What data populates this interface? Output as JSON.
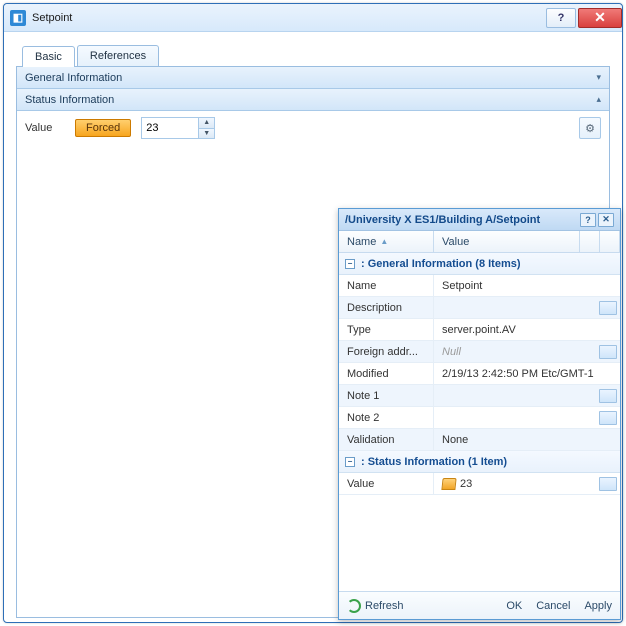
{
  "window": {
    "title": "Setpoint",
    "icon": "setpoint-icon"
  },
  "tabs": [
    {
      "label": "Basic",
      "active": true
    },
    {
      "label": "References",
      "active": false
    }
  ],
  "sections": {
    "general": {
      "title": "General Information",
      "expanded": false
    },
    "status": {
      "title": "Status Information",
      "expanded": true
    }
  },
  "value_row": {
    "label": "Value",
    "forced_badge": "Forced",
    "value": "23"
  },
  "panel2": {
    "path": "/University X ES1/Building A/Setpoint",
    "columns": {
      "name": "Name",
      "value": "Value"
    },
    "group_general": {
      "label": ": General Information (8 Items)"
    },
    "group_status": {
      "label": ": Status Information (1 Item)"
    },
    "general_rows": [
      {
        "name": "Name",
        "value": "Setpoint",
        "editable": false
      },
      {
        "name": "Description",
        "value": "",
        "editable": true
      },
      {
        "name": "Type",
        "value": "server.point.AV",
        "editable": false
      },
      {
        "name": "Foreign addr...",
        "value": "Null",
        "null": true,
        "editable": true
      },
      {
        "name": "Modified",
        "value": "2/19/13 2:42:50 PM Etc/GMT-1",
        "editable": false
      },
      {
        "name": "Note 1",
        "value": "",
        "editable": true
      },
      {
        "name": "Note 2",
        "value": "",
        "editable": true
      },
      {
        "name": "Validation",
        "value": "None",
        "editable": false
      }
    ],
    "status_rows": [
      {
        "name": "Value",
        "value": "23",
        "forced": true,
        "editable": true
      }
    ],
    "footer": {
      "refresh": "Refresh",
      "ok": "OK",
      "cancel": "Cancel",
      "apply": "Apply"
    }
  }
}
